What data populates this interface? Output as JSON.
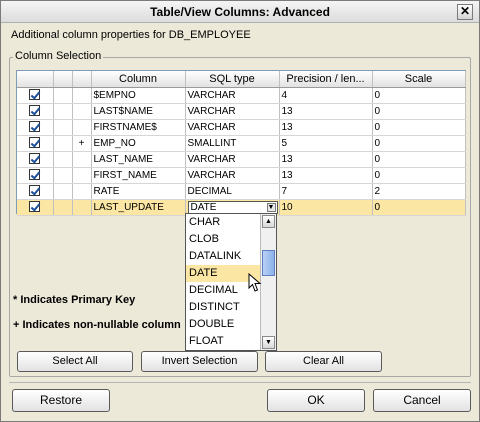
{
  "dialog": {
    "title": "Table/View Columns: Advanced",
    "close_glyph": "✕"
  },
  "subtitle": "Additional column properties for DB_EMPLOYEE",
  "group_label": "Column Selection",
  "table": {
    "columns": [
      "",
      "",
      "",
      "Column",
      "SQL type",
      "Precision / len...",
      "Scale"
    ],
    "rows": [
      {
        "checked": true,
        "marker": "",
        "name": "$EMPNO",
        "type": "VARCHAR",
        "precision": "4",
        "scale": "0"
      },
      {
        "checked": true,
        "marker": "",
        "name": "LAST$NAME",
        "type": "VARCHAR",
        "precision": "13",
        "scale": "0"
      },
      {
        "checked": true,
        "marker": "",
        "name": "FIRSTNAME$",
        "type": "VARCHAR",
        "precision": "13",
        "scale": "0"
      },
      {
        "checked": true,
        "marker": "+",
        "name": "EMP_NO",
        "type": "SMALLINT",
        "precision": "5",
        "scale": "0"
      },
      {
        "checked": true,
        "marker": "",
        "name": "LAST_NAME",
        "type": "VARCHAR",
        "precision": "13",
        "scale": "0"
      },
      {
        "checked": true,
        "marker": "",
        "name": "FIRST_NAME",
        "type": "VARCHAR",
        "precision": "13",
        "scale": "0"
      },
      {
        "checked": true,
        "marker": "",
        "name": "RATE",
        "type": "DECIMAL",
        "precision": "7",
        "scale": "2"
      },
      {
        "checked": true,
        "marker": "",
        "name": "LAST_UPDATE",
        "type": "DATE",
        "precision": "10",
        "scale": "0",
        "selected": true
      }
    ]
  },
  "dropdown": {
    "options": [
      "CHAR",
      "CLOB",
      "DATALINK",
      "DATE",
      "DECIMAL",
      "DISTINCT",
      "DOUBLE",
      "FLOAT"
    ],
    "highlighted": "DATE"
  },
  "legend": {
    "primary_key": "* Indicates Primary Key",
    "non_nullable": "+ Indicates non-nullable column"
  },
  "buttons": {
    "select_all": "Select All",
    "invert_selection": "Invert Selection",
    "clear_all": "Clear All",
    "restore": "Restore",
    "ok": "OK",
    "cancel": "Cancel"
  },
  "colors": {
    "selected_row": "#fbe7a3",
    "dialog_bg": "#ece9d8"
  }
}
